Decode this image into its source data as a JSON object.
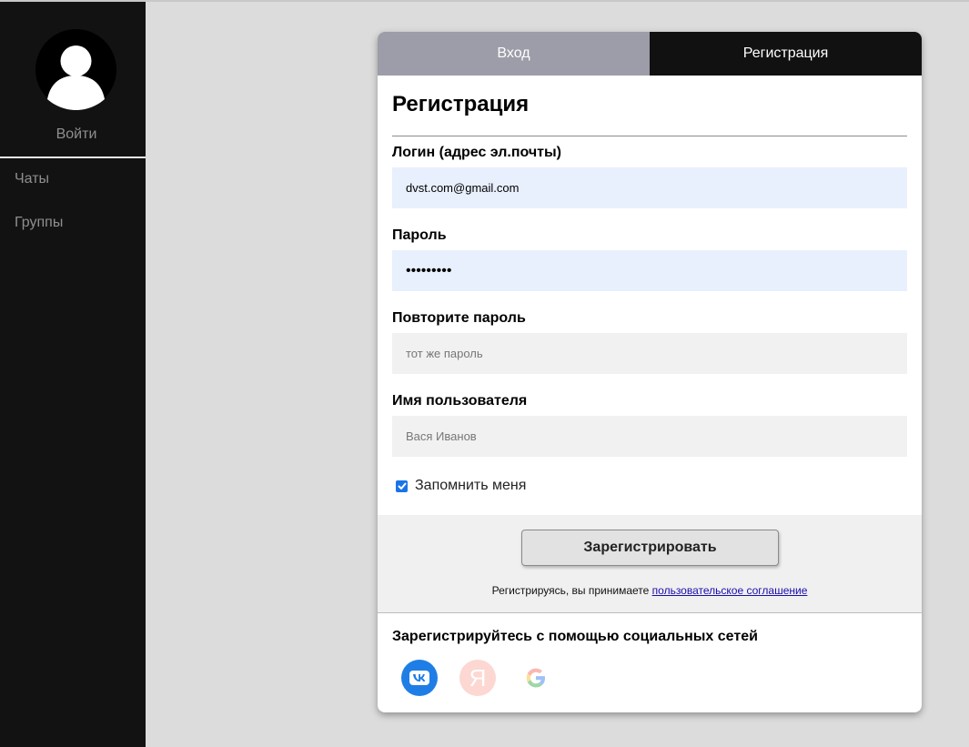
{
  "sidebar": {
    "login_label": "Войти",
    "items": [
      {
        "label": "Чаты"
      },
      {
        "label": "Группы"
      }
    ]
  },
  "tabs": [
    {
      "label": "Вход",
      "active": false
    },
    {
      "label": "Регистрация",
      "active": true
    }
  ],
  "form": {
    "title": "Регистрация",
    "login": {
      "label": "Логин (адрес эл.почты)",
      "value": "dvst.com@gmail.com"
    },
    "password": {
      "label": "Пароль",
      "value": "•••••••••"
    },
    "repeat_password": {
      "label": "Повторите пароль",
      "placeholder": "тот же пароль"
    },
    "username": {
      "label": "Имя пользователя",
      "placeholder": "Вася Иванов"
    },
    "remember": {
      "label": "Запомнить меня",
      "checked": true
    },
    "submit_label": "Зарегистрировать",
    "agreement_text": "Регистрируясь, вы принимаете",
    "agreement_link": "пользовательское соглашение"
  },
  "social": {
    "title": "Зарегистрируйтесь с помощью социальных сетей",
    "yandex_letter": "Я",
    "icons": [
      "vk-icon",
      "yandex-icon",
      "google-icon"
    ]
  },
  "colors": {
    "sidebar_bg": "#121212",
    "tab_inactive": "#9d9da9",
    "tab_active": "#111111",
    "input_filled": "#e8f0fe",
    "input_empty": "#f1f1f1",
    "vk": "#1f7ee6",
    "yandex": "#fdd7d2",
    "checkbox": "#1a73e8"
  }
}
